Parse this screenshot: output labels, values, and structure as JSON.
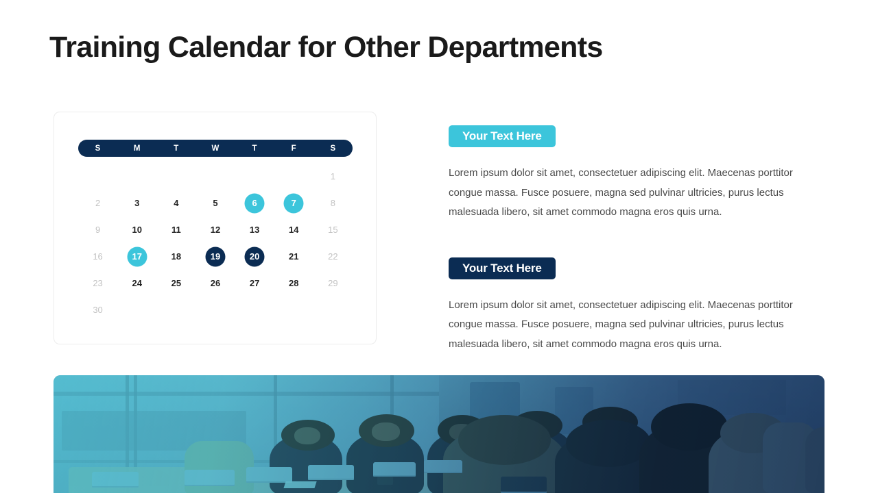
{
  "page": {
    "title": "Training Calendar for Other Departments",
    "background_color": "#ffffff"
  },
  "colors": {
    "navy": "#0b2c53",
    "cyan": "#3cc5db",
    "title_text": "#1a1a1a",
    "body_text": "#4a4a4a",
    "muted_day": "#c2c2c2",
    "active_day": "#222222",
    "card_border": "#ececec"
  },
  "calendar": {
    "weekday_headers": [
      "S",
      "M",
      "T",
      "W",
      "T",
      "F",
      "S"
    ],
    "weeks": [
      [
        {
          "day": "",
          "state": "empty"
        },
        {
          "day": "",
          "state": "empty"
        },
        {
          "day": "",
          "state": "empty"
        },
        {
          "day": "",
          "state": "empty"
        },
        {
          "day": "",
          "state": "empty"
        },
        {
          "day": "",
          "state": "empty"
        },
        {
          "day": "1",
          "state": "muted"
        }
      ],
      [
        {
          "day": "2",
          "state": "muted"
        },
        {
          "day": "3",
          "state": "normal"
        },
        {
          "day": "4",
          "state": "normal"
        },
        {
          "day": "5",
          "state": "normal"
        },
        {
          "day": "6",
          "state": "highlight-cyan"
        },
        {
          "day": "7",
          "state": "highlight-cyan"
        },
        {
          "day": "8",
          "state": "muted"
        }
      ],
      [
        {
          "day": "9",
          "state": "muted"
        },
        {
          "day": "10",
          "state": "normal"
        },
        {
          "day": "11",
          "state": "normal"
        },
        {
          "day": "12",
          "state": "normal"
        },
        {
          "day": "13",
          "state": "normal"
        },
        {
          "day": "14",
          "state": "normal"
        },
        {
          "day": "15",
          "state": "muted"
        }
      ],
      [
        {
          "day": "16",
          "state": "muted"
        },
        {
          "day": "17",
          "state": "highlight-cyan"
        },
        {
          "day": "18",
          "state": "normal"
        },
        {
          "day": "19",
          "state": "highlight-navy"
        },
        {
          "day": "20",
          "state": "highlight-navy"
        },
        {
          "day": "21",
          "state": "normal"
        },
        {
          "day": "22",
          "state": "muted"
        }
      ],
      [
        {
          "day": "23",
          "state": "muted"
        },
        {
          "day": "24",
          "state": "normal"
        },
        {
          "day": "25",
          "state": "normal"
        },
        {
          "day": "26",
          "state": "normal"
        },
        {
          "day": "27",
          "state": "normal"
        },
        {
          "day": "28",
          "state": "normal"
        },
        {
          "day": "29",
          "state": "muted"
        }
      ],
      [
        {
          "day": "30",
          "state": "muted"
        },
        {
          "day": "",
          "state": "empty"
        },
        {
          "day": "",
          "state": "empty"
        },
        {
          "day": "",
          "state": "empty"
        },
        {
          "day": "",
          "state": "empty"
        },
        {
          "day": "",
          "state": "empty"
        },
        {
          "day": "",
          "state": "empty"
        }
      ]
    ]
  },
  "content_blocks": [
    {
      "button_label": "Your Text Here",
      "button_style": "cyan",
      "paragraph": "Lorem ipsum dolor sit amet, consectetuer adipiscing elit. Maecenas porttitor congue massa. Fusce posuere, magna sed pulvinar ultricies, purus lectus malesuada libero, sit amet commodo magna eros quis urna."
    },
    {
      "button_label": "Your Text Here",
      "button_style": "navy",
      "paragraph": "Lorem ipsum dolor sit amet, consectetuer adipiscing elit. Maecenas porttitor congue massa. Fusce posuere, magna sed pulvinar ultricies, purus lectus malesuada libero, sit amet commodo magna eros quis urna."
    }
  ],
  "photo_banner": {
    "description": "Conference room meeting with people at laptops",
    "tint_from": "#3cc5db",
    "tint_to": "#0e305c"
  }
}
